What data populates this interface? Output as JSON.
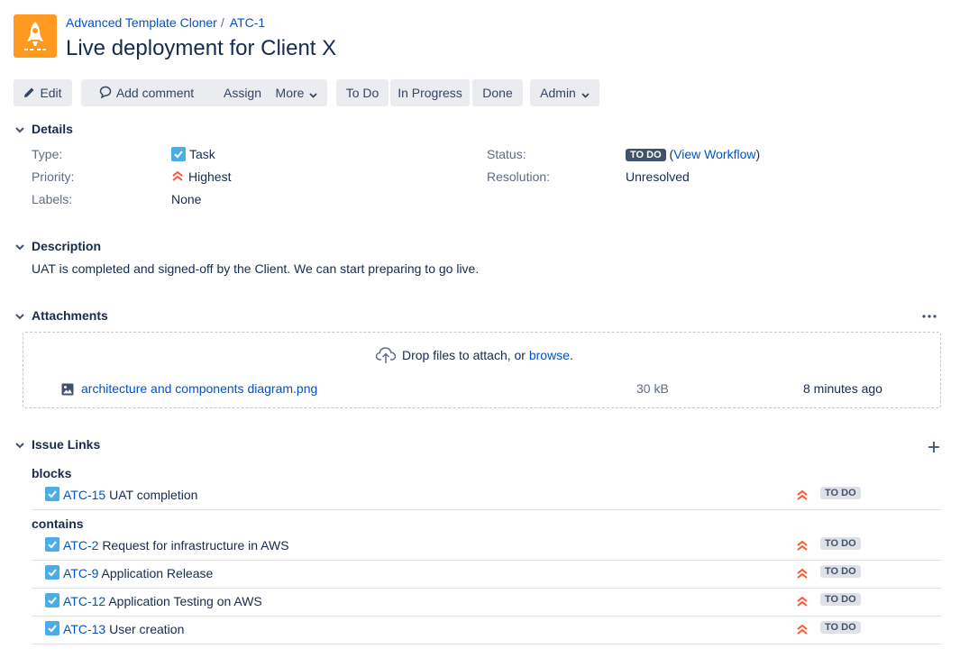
{
  "breadcrumb": {
    "project": "Advanced Template Cloner",
    "separator": "/",
    "issue_key": "ATC-1"
  },
  "title": "Live deployment for Client X",
  "toolbar": {
    "edit": "Edit",
    "add_comment": "Add comment",
    "assign": "Assign",
    "more": "More",
    "to_do": "To Do",
    "in_progress": "In Progress",
    "done": "Done",
    "admin": "Admin"
  },
  "details": {
    "heading": "Details",
    "type_label": "Type:",
    "type_value": "Task",
    "priority_label": "Priority:",
    "priority_value": "Highest",
    "labels_label": "Labels:",
    "labels_value": "None",
    "status_label": "Status:",
    "status_value": "TO DO",
    "view_workflow": "View Workflow",
    "resolution_label": "Resolution:",
    "resolution_value": "Unresolved"
  },
  "description": {
    "heading": "Description",
    "text": "UAT is completed and signed-off by the Client. We can start preparing to go live."
  },
  "attachments": {
    "heading": "Attachments",
    "drop_text": "Drop files to attach, or",
    "browse": "browse",
    "period": ".",
    "file": {
      "name": "architecture and components diagram.png",
      "size": "30 kB",
      "age": "8 minutes ago"
    }
  },
  "issue_links": {
    "heading": "Issue Links",
    "groups": [
      {
        "label": "blocks",
        "items": [
          {
            "key": "ATC-15",
            "summary": "UAT completion",
            "status": "TO DO"
          }
        ]
      },
      {
        "label": "contains",
        "items": [
          {
            "key": "ATC-2",
            "summary": "Request for infrastructure in AWS",
            "status": "TO DO"
          },
          {
            "key": "ATC-9",
            "summary": "Application Release",
            "status": "TO DO"
          },
          {
            "key": "ATC-12",
            "summary": "Application Testing on AWS",
            "status": "TO DO"
          },
          {
            "key": "ATC-13",
            "summary": "User creation",
            "status": "TO DO"
          }
        ]
      }
    ]
  },
  "icons": {
    "project_avatar": "rocket-icon",
    "edit": "pencil-icon",
    "comment": "speech-bubble-icon",
    "type": "checkbox-task-icon",
    "priority": "double-chevron-up-icon",
    "upload": "cloud-upload-icon",
    "file": "image-file-icon",
    "more_actions": "ellipsis-icon",
    "add_link": "plus-icon"
  },
  "colors": {
    "accent": "#0052cc",
    "priority": "#ff5630",
    "project_avatar": "#ff991f",
    "status_dark": "#42526e",
    "button_bg": "#ebecf0"
  }
}
